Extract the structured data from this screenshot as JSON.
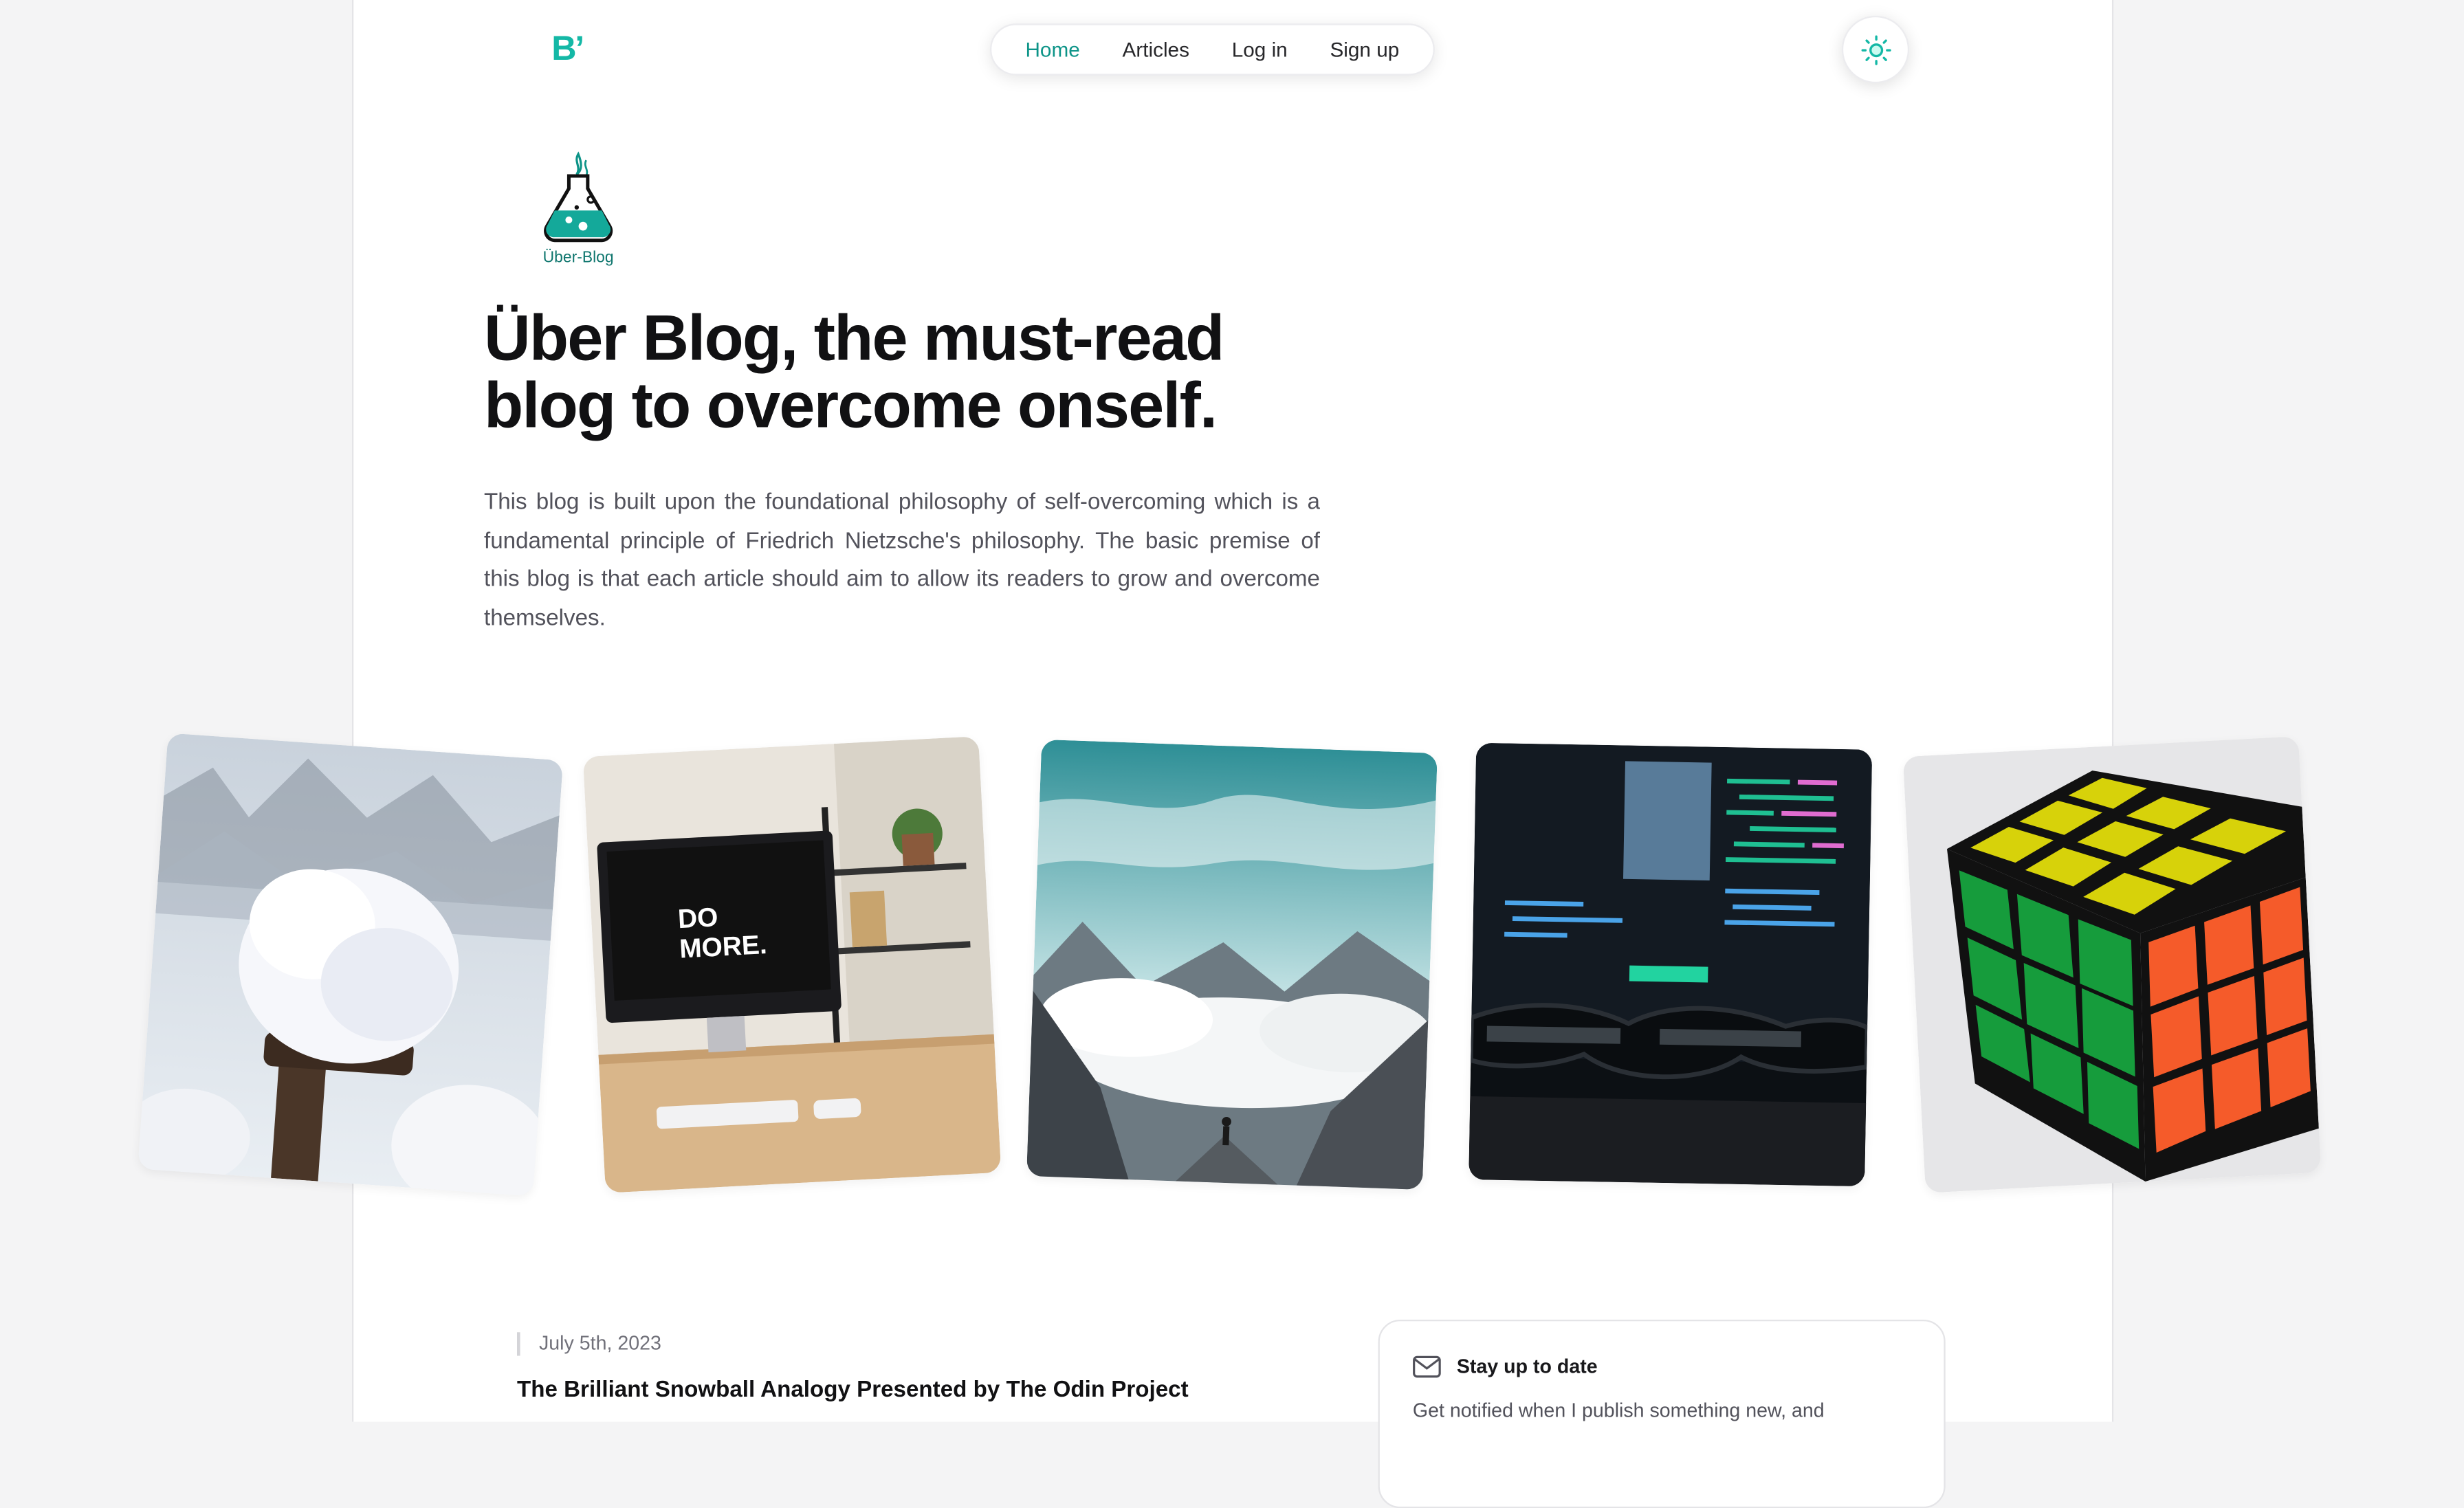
{
  "header": {
    "logo_text": "B’",
    "nav": [
      "Home",
      "Articles",
      "Log in",
      "Sign up"
    ],
    "active_nav": "Home",
    "theme_toggle_icon": "sun-icon"
  },
  "brand": {
    "label": "Über-Blog",
    "icon": "flask-icon"
  },
  "hero": {
    "title": "Über Blog, the must-read blog to overcome onself.",
    "description": "This blog is built upon the foundational philosophy of self-overcoming which is a fundamental principle of Friedrich Nietzsche's philosophy. The basic premise of this blog is that each article should aim to allow its readers to grow and overcome themselves."
  },
  "gallery": [
    {
      "name": "snow-photo",
      "text": ""
    },
    {
      "name": "desk-photo",
      "text": "DO MORE."
    },
    {
      "name": "mountain-photo",
      "text": ""
    },
    {
      "name": "code-photo",
      "text": ""
    },
    {
      "name": "rubiks-cube-photo",
      "text": ""
    }
  ],
  "latest_article": {
    "date": "July 5th, 2023",
    "title": "The Brilliant Snowball Analogy Presented by The Odin Project"
  },
  "newsletter": {
    "icon": "mail-icon",
    "title": "Stay up to date",
    "text": "Get notified when I publish something new, and"
  },
  "colors": {
    "accent": "#14b8a6",
    "accent_dark": "#0d9488",
    "background": "#f4f4f5"
  }
}
